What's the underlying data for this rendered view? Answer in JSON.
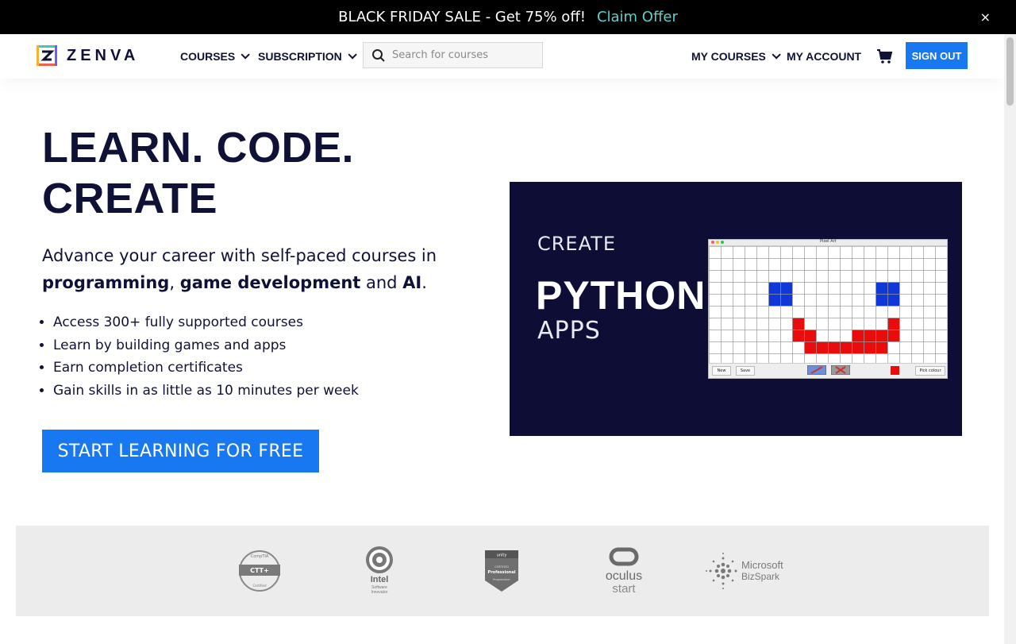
{
  "promo": {
    "text": "BLACK FRIDAY SALE - Get 75% off!",
    "link": "Claim Offer",
    "close": "×"
  },
  "header": {
    "brand": "ZENVA",
    "nav_courses": "COURSES",
    "nav_subscription": "SUBSCRIPTION",
    "search_placeholder": "Search for courses",
    "my_courses": "MY COURSES",
    "my_account": "MY ACCOUNT",
    "sign_out": "SIGN OUT",
    "icons": [
      "search-icon",
      "cart-icon",
      "chevron-down-icon"
    ]
  },
  "hero": {
    "title_line1": "LEARN. CODE.",
    "title_line2": "CREATE",
    "sub_intro": "Advance your career with self-paced courses in ",
    "sub_b1": "programming",
    "sub_comma": ", ",
    "sub_b2": "game development",
    "sub_and": " and ",
    "sub_b3": "AI",
    "sub_end": ".",
    "bullets": [
      "Access 300+ fully supported courses",
      "Learn by building games and apps",
      "Earn completion certificates",
      "Gain skills in as little as 10 minutes per week"
    ],
    "cta": "START LEARNING FOR FREE"
  },
  "hero_image": {
    "line1": "CREATE",
    "line2": "PYTHON",
    "line3": "APPS",
    "window_title": "Pixel Art",
    "btn_new": "New",
    "btn_save": "Save",
    "btn_pick": "Pick colour",
    "colors": {
      "blue": "#1038d8",
      "red": "#e80c0c",
      "bg": "#0d0d36"
    }
  },
  "partners": {
    "comptia_top": "CompTIA",
    "comptia_mid": "CTT+",
    "comptia_bot": "Certified",
    "intel_name": "Intel",
    "intel_sub1": "Software",
    "intel_sub2": "Innovator",
    "unity_top": "unity",
    "unity_mid1": "CERTIFIED",
    "unity_mid2": "Professional",
    "unity_bot": "Programmer",
    "oculus_name": "oculus",
    "oculus_sub": "start",
    "ms_name": "Microsoft",
    "ms_sub": "BizSpark"
  },
  "theme": {
    "accent": "#1778f2",
    "ink": "#0f1236",
    "promo_link": "#5ed0cc"
  }
}
